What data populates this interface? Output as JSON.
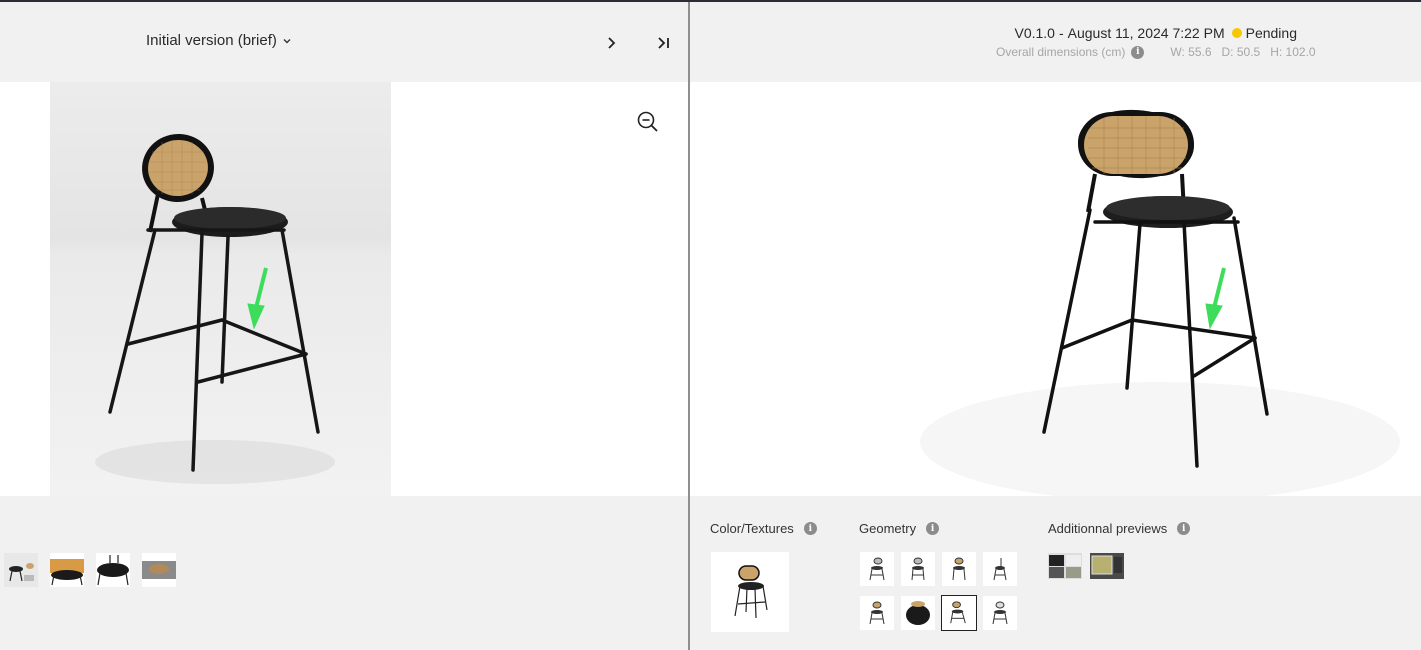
{
  "left_header": {
    "version_label": "Initial version (brief)"
  },
  "right_header": {
    "version": "V0.1.0",
    "separator": "-",
    "date": "August 11, 2024 7:22 PM",
    "status": "Pending",
    "status_color": "#f5c800",
    "dims_label": "Overall dimensions (cm)",
    "dims": {
      "w": "W: 55.6",
      "d": "D: 50.5",
      "h": "H: 102.0"
    }
  },
  "sections": {
    "color_textures": "Color/Textures",
    "geometry": "Geometry",
    "additional_previews": "Additionnal previews"
  },
  "icons": {
    "version_dropdown": "chevron-down-icon",
    "next": "chevron-right-icon",
    "last": "skip-to-end-icon",
    "zoom": "zoom-out-icon",
    "info": "info-icon",
    "annotation": "green-arrow-marker"
  },
  "colors": {
    "annotation_arrow": "#3ddc5a",
    "status_pending": "#f5c800"
  },
  "info_glyph": "i"
}
